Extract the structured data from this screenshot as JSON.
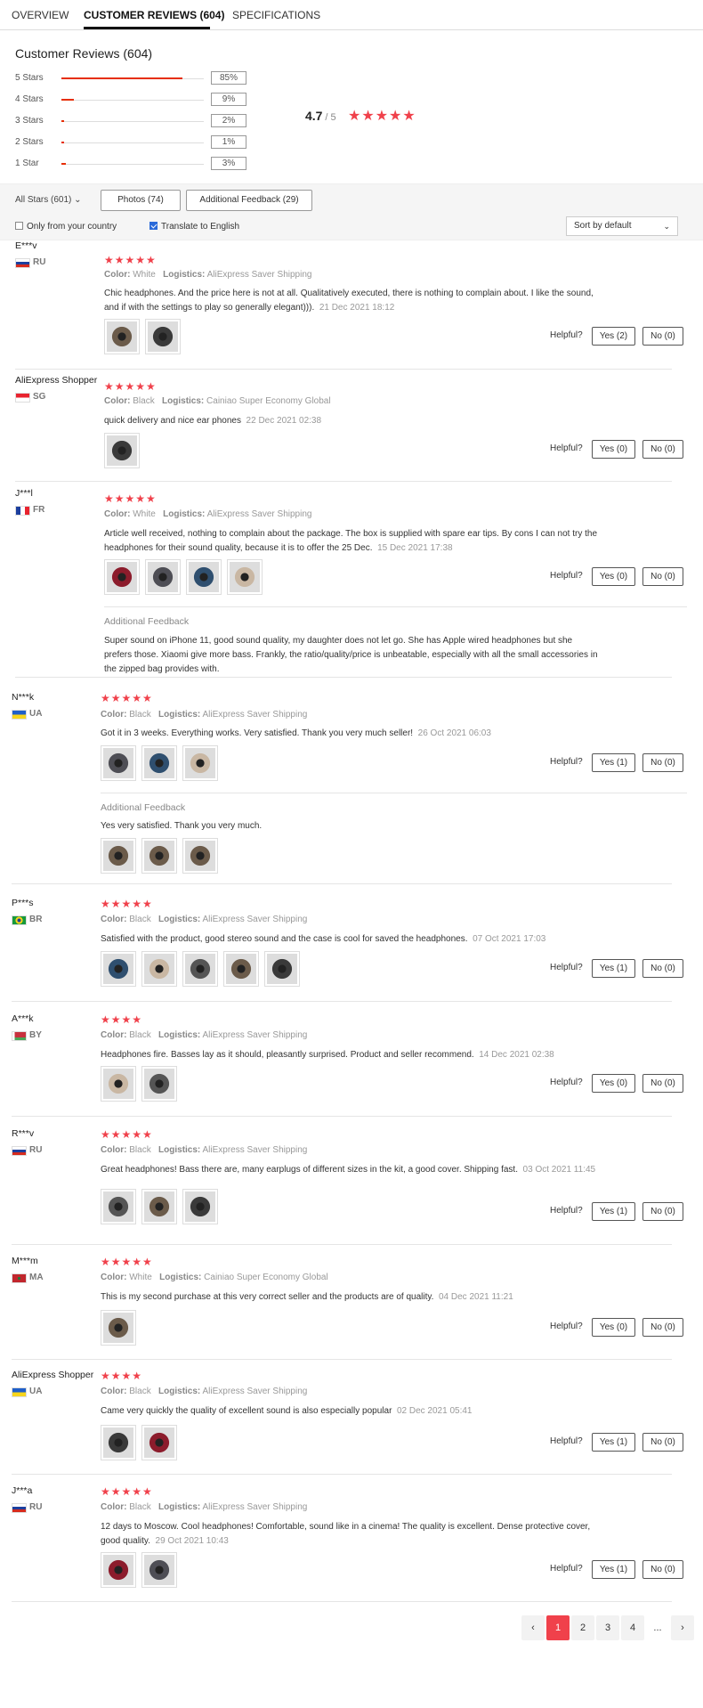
{
  "tabs": [
    "OVERVIEW",
    "CUSTOMER REVIEWS (604)",
    "SPECIFICATIONS"
  ],
  "summary": {
    "title": "Customer Reviews (604)",
    "rows": [
      {
        "label": "5 Stars",
        "pct": "85%",
        "fill": 0.85
      },
      {
        "label": "4 Stars",
        "pct": "9%",
        "fill": 0.09
      },
      {
        "label": "3 Stars",
        "pct": "2%",
        "fill": 0.02
      },
      {
        "label": "2 Stars",
        "pct": "1%",
        "fill": 0.01
      },
      {
        "label": "1 Star",
        "pct": "3%",
        "fill": 0.03
      }
    ],
    "rating": "4.7",
    "rating_of": "/ 5",
    "stars": "★★★★★"
  },
  "filters": {
    "all_stars": "All Stars (601)",
    "photos": "Photos (74)",
    "additional": "Additional Feedback (29)",
    "only_country": "Only from your country",
    "translate": "Translate to English",
    "sort": "Sort by default"
  },
  "labels": {
    "color": "Color:",
    "logistics": "Logistics:",
    "helpful": "Helpful?",
    "additional_feedback": "Additional Feedback"
  },
  "colors": {
    "accent": "#f0414b",
    "fill": "#e62e04"
  },
  "reviews": [
    {
      "name": "E***v",
      "country": "RU",
      "stars": "★★★★★",
      "color": "White",
      "logistics": "AliExpress Saver Shipping",
      "text": "Chic headphones. And the price here is not at all. Qualitatively executed, there is nothing to complain about. I like the sound, and if with the settings to play so generally elegant))).",
      "date": "21 Dec 2021 18:12",
      "yes": "Yes (2)",
      "no": "No (0)",
      "photos": 2
    },
    {
      "name": "AliExpress Shopper",
      "country": "SG",
      "stars": "★★★★★",
      "color": "Black",
      "logistics": "Cainiao Super Economy Global",
      "text": "quick delivery and nice ear phones",
      "date": "22 Dec 2021 02:38",
      "yes": "Yes (0)",
      "no": "No (0)",
      "photos": 1
    },
    {
      "name": "J***l",
      "country": "FR",
      "stars": "★★★★★",
      "color": "White",
      "logistics": "AliExpress Saver Shipping",
      "text": "Article well received, nothing to complain about the package. The box is supplied with spare ear tips. By cons I can not try the headphones for their sound quality, because it is to offer the 25 Dec.",
      "date": "15 Dec 2021 17:38",
      "yes": "Yes (0)",
      "no": "No (0)",
      "photos": 4,
      "additional": "Super sound on iPhone 11, good sound quality, my daughter does not let go. She has Apple wired headphones but she prefers those. Xiaomi give more bass. Frankly, the ratio/quality/price is unbeatable, especially with all the small accessories in the zipped bag provides with."
    },
    {
      "name": "N***k",
      "country": "UA",
      "stars": "★★★★★",
      "color": "Black",
      "logistics": "AliExpress Saver Shipping",
      "text": "Got it in 3 weeks. Everything works. Very satisfied. Thank you very much seller!",
      "date": "26 Oct 2021 06:03",
      "yes": "Yes (1)",
      "no": "No (0)",
      "photos": 3,
      "additional": "Yes very satisfied. Thank you very much."
    },
    {
      "name": "P***s",
      "country": "BR",
      "stars": "★★★★★",
      "color": "Black",
      "logistics": "AliExpress Saver Shipping",
      "text": "Satisfied with the product, good stereo sound and the case is cool for saved the headphones.",
      "date": "07 Oct 2021 17:03",
      "yes": "Yes (1)",
      "no": "No (0)",
      "photos": 5
    },
    {
      "name": "A***k",
      "country": "BY",
      "stars": "★★★★",
      "color": "Black",
      "logistics": "AliExpress Saver Shipping",
      "text": "Headphones fire. Basses lay as it should, pleasantly surprised. Product and seller recommend.",
      "date": "14 Dec 2021 02:38",
      "yes": "Yes (0)",
      "no": "No (0)",
      "photos": 2
    },
    {
      "name": "R***v",
      "country": "RU",
      "stars": "★★★★★",
      "color": "Black",
      "logistics": "AliExpress Saver Shipping",
      "text": "Great headphones! Bass there are, many earplugs of different sizes in the kit, a good cover. Shipping fast.",
      "date": "03 Oct 2021 11:45",
      "yes": "Yes (1)",
      "no": "No (0)",
      "photos": 3
    },
    {
      "name": "M***m",
      "country": "MA",
      "stars": "★★★★★",
      "color": "White",
      "logistics": "Cainiao Super Economy Global",
      "text": "This is my second purchase at this very correct seller and the products are of quality.",
      "date": "04 Dec 2021 11:21",
      "yes": "Yes (0)",
      "no": "No (0)",
      "photos": 1
    },
    {
      "name": "AliExpress Shopper",
      "country": "UA",
      "stars": "★★★★",
      "color": "Black",
      "logistics": "AliExpress Saver Shipping",
      "text": "Came very quickly the quality of excellent sound is also especially popular",
      "date": "02 Dec 2021 05:41",
      "yes": "Yes (1)",
      "no": "No (0)",
      "photos": 2
    },
    {
      "name": "J***a",
      "country": "RU",
      "stars": "★★★★★",
      "color": "Black",
      "logistics": "AliExpress Saver Shipping",
      "text": "12 days to Moscow. Cool headphones! Comfortable, sound like in a cinema! The quality is excellent. Dense protective cover, good quality.",
      "date": "29 Oct 2021 10:43",
      "yes": "Yes (1)",
      "no": "No (0)",
      "photos": 2
    }
  ],
  "pager": {
    "prev": "‹",
    "pages": [
      "1",
      "2",
      "3",
      "4"
    ],
    "ellipsis": "...",
    "next": "›",
    "active": "1"
  }
}
